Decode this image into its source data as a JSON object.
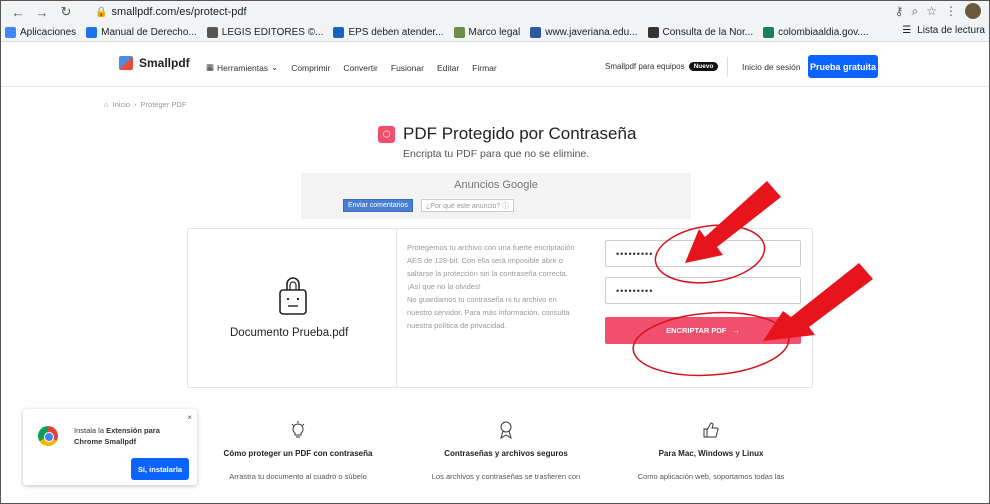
{
  "browser": {
    "url": "smallpdf.com/es/protect-pdf",
    "bookmarks": [
      {
        "label": "Aplicaciones",
        "color": "#4285f4"
      },
      {
        "label": "Manual de Derecho...",
        "color": "#1a73e8"
      },
      {
        "label": "LEGIS EDITORES ©...",
        "color": "#555555"
      },
      {
        "label": "EPS deben atender...",
        "color": "#1565c0"
      },
      {
        "label": "Marco legal",
        "color": "#6d8f4a"
      },
      {
        "label": "www.javeriana.edu...",
        "color": "#2c5aa0"
      },
      {
        "label": "Consulta de la Nor...",
        "color": "#333333"
      },
      {
        "label": "colombiaaldia.gov....",
        "color": "#1a7f5a"
      }
    ],
    "reading_list": "Lista de lectura"
  },
  "header": {
    "logo": "Smallpdf",
    "nav": [
      "Herramientas",
      "Comprimir",
      "Convertir",
      "Fusionar",
      "Editar",
      "Firmar"
    ],
    "team_label": "Smallpdf para equipos",
    "team_badge": "Nuevo",
    "login": "Inicio de sesión",
    "trial": "Prueba gratuita"
  },
  "breadcrumb": {
    "home": "Inicio",
    "separator": "›",
    "current": "Proteger PDF"
  },
  "hero": {
    "title": "PDF Protegido por Contraseña",
    "subtitle": "Encripta tu PDF para que no se elimine."
  },
  "ads": {
    "label": "Anuncios Google",
    "feedback": "Enviar comentarios",
    "why": "¿Por qué este anuncio? ⓘ"
  },
  "card": {
    "file_name": "Documento Prueba.pdf",
    "info_lines": [
      "Protegemos tu archivo con una fuerte encriptación",
      "AES de 128-bit. Con ella será imposible abrir o",
      "saltarse la protección sin la contraseña correcta.",
      "¡Así que no la olvides!",
      "No guardamos tu contraseña ni tu archivo en",
      "nuestro servidor. Para más información, consulta",
      "nuestra política de privacidad."
    ],
    "password_1": "•••••••••",
    "password_2": "•••••••••",
    "encrypt_button": "ENCRIPTAR PDF"
  },
  "features": [
    {
      "title": "Cómo proteger un PDF con contraseña",
      "text": "Arrastra tu documento al cuadro o súbelo",
      "icon": "lightbulb-icon"
    },
    {
      "title": "Contraseñas y archivos seguros",
      "text": "Los archivos y contraseñas se trasfieren con",
      "icon": "award-icon"
    },
    {
      "title": "Para Mac, Windows y Linux",
      "text": "Como aplicación web, soportamos todas las",
      "icon": "thumbs-up-icon"
    }
  ],
  "extension_popup": {
    "text_plain_1": "Instala la ",
    "text_bold_1": "Extensión para",
    "text_bold_2": "Chrome Smallpdf",
    "button": "Sí, instalarla"
  },
  "annotation_colors": {
    "arrow": "#e8141b",
    "ellipse": "#d6121a"
  }
}
